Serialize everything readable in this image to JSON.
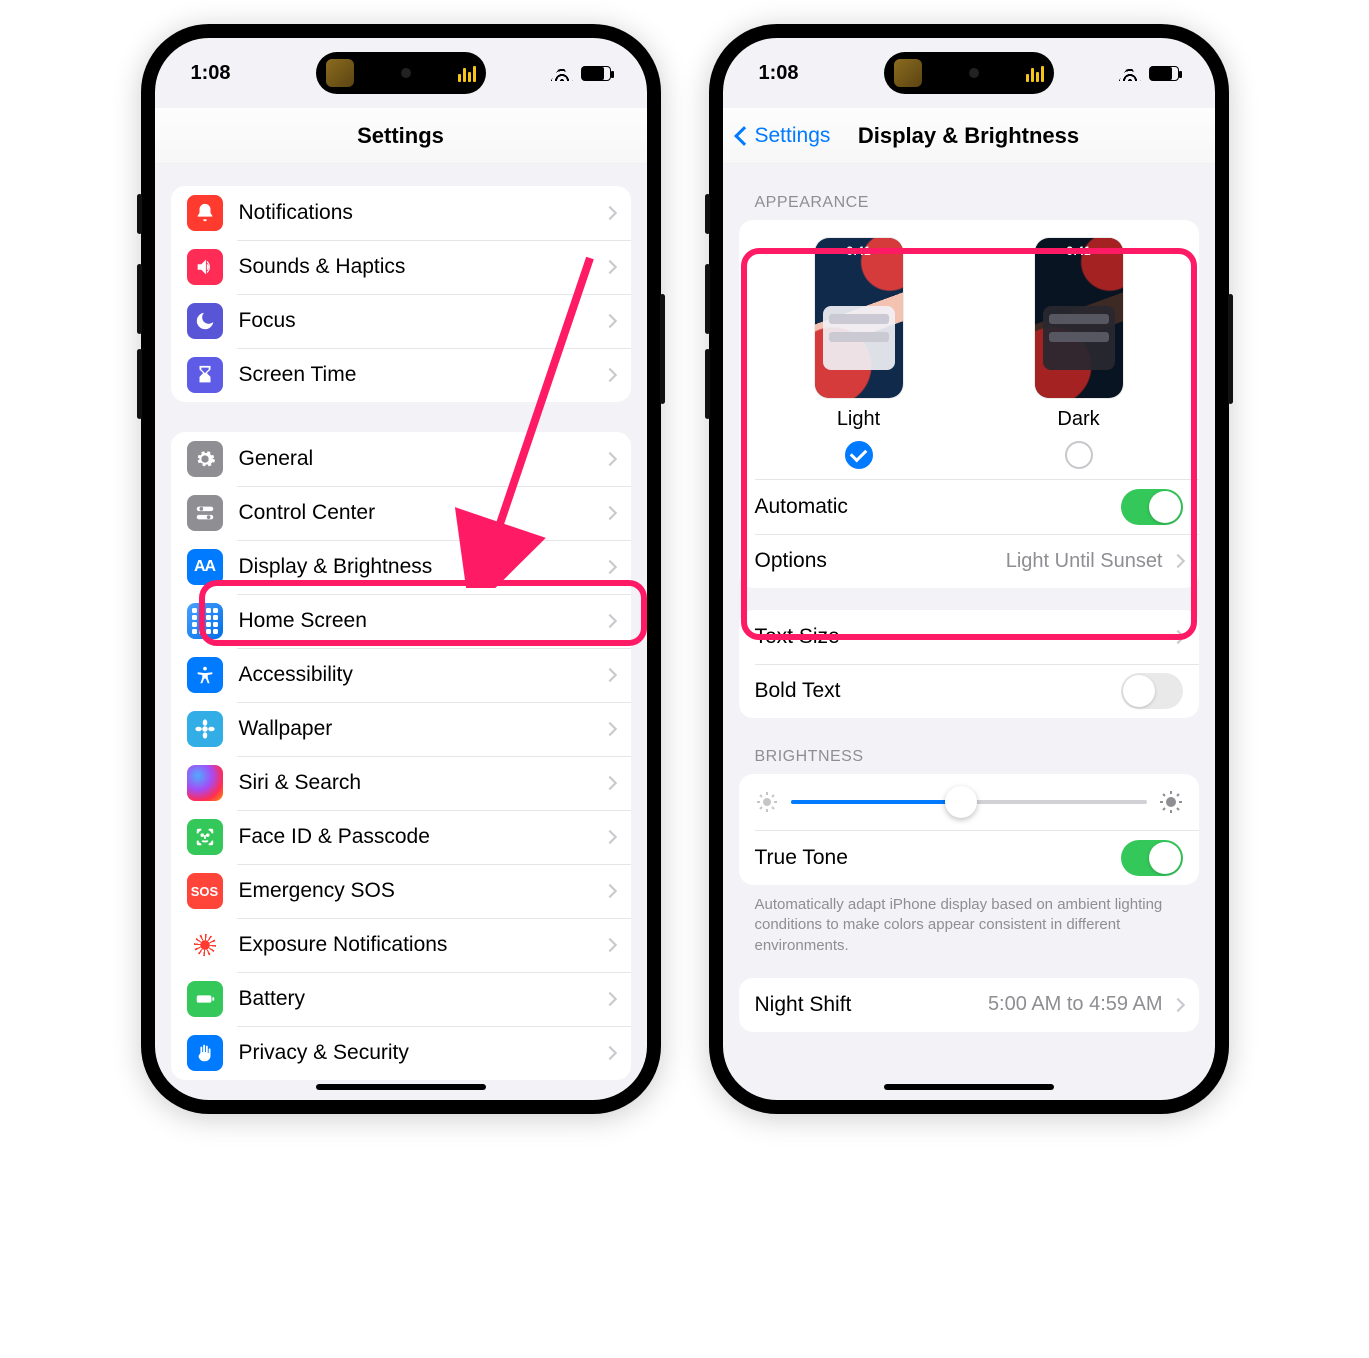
{
  "status": {
    "time": "1:08"
  },
  "left": {
    "title": "Settings",
    "group1": [
      {
        "label": "Notifications",
        "icon": "bell",
        "color": "c-red"
      },
      {
        "label": "Sounds & Haptics",
        "icon": "speaker",
        "color": "c-pink"
      },
      {
        "label": "Focus",
        "icon": "moon",
        "color": "c-purple"
      },
      {
        "label": "Screen Time",
        "icon": "hourglass",
        "color": "c-purple2"
      }
    ],
    "group2": [
      {
        "label": "General",
        "icon": "gear",
        "color": "c-gray"
      },
      {
        "label": "Control Center",
        "icon": "switches",
        "color": "c-gray"
      },
      {
        "label": "Display & Brightness",
        "icon": "aa",
        "color": "c-blue",
        "highlight": true
      },
      {
        "label": "Home Screen",
        "icon": "grid",
        "color": "icon-grid"
      },
      {
        "label": "Accessibility",
        "icon": "person",
        "color": "c-blue"
      },
      {
        "label": "Wallpaper",
        "icon": "flower",
        "color": "c-teal"
      },
      {
        "label": "Siri & Search",
        "icon": "siri",
        "color": "icon-siri"
      },
      {
        "label": "Face ID & Passcode",
        "icon": "face",
        "color": "c-green"
      },
      {
        "label": "Emergency SOS",
        "icon": "sos",
        "color": "c-red2"
      },
      {
        "label": "Exposure Notifications",
        "icon": "exposure",
        "color": "icon-exp"
      },
      {
        "label": "Battery",
        "icon": "battery",
        "color": "c-green"
      },
      {
        "label": "Privacy & Security",
        "icon": "hand",
        "color": "c-blue"
      }
    ]
  },
  "right": {
    "back": "Settings",
    "title": "Display & Brightness",
    "appearance_header": "APPEARANCE",
    "preview_time": "9:41",
    "light_label": "Light",
    "dark_label": "Dark",
    "automatic": "Automatic",
    "options": "Options",
    "options_value": "Light Until Sunset",
    "text_size": "Text Size",
    "bold_text": "Bold Text",
    "brightness_header": "BRIGHTNESS",
    "true_tone": "True Tone",
    "true_tone_footer": "Automatically adapt iPhone display based on ambient lighting conditions to make colors appear consistent in different environments.",
    "night_shift": "Night Shift",
    "night_shift_value": "5:00 AM to 4:59 AM"
  }
}
